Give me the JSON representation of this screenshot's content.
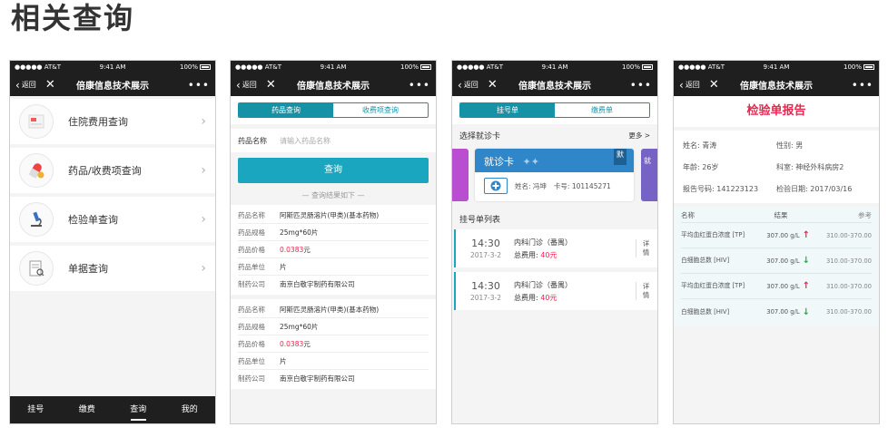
{
  "page_title": "相关查询",
  "status_bar": {
    "carrier": "●●●●● AT&T",
    "time": "9:41 AM",
    "battery": "100%"
  },
  "nav": {
    "back_label": "返回",
    "title": "倍康信息技术展示"
  },
  "phone1": {
    "menu": [
      {
        "label": "住院费用查询",
        "icon": "hospital-bill-icon"
      },
      {
        "label": "药品/收费项查询",
        "icon": "pill-icon"
      },
      {
        "label": "检验单查询",
        "icon": "microscope-icon"
      },
      {
        "label": "单据查询",
        "icon": "receipt-icon"
      }
    ],
    "tabs": [
      "挂号",
      "缴费",
      "查询",
      "我的"
    ],
    "active_tab": "查询"
  },
  "phone2": {
    "segments": [
      "药品查询",
      "收费项查询"
    ],
    "field_label": "药品名称",
    "field_placeholder": "请输入药品名称",
    "query_button": "查询",
    "divider": "— 查询结果如下 —",
    "result_keys": [
      "药品名称",
      "药品规格",
      "药品价格",
      "药品单位",
      "制药公司"
    ],
    "results": [
      {
        "name": "阿斯匹灵肠溶片(甲类)(基本药物)",
        "spec": "25mg*60片",
        "price": "0.0383",
        "price_unit": "元",
        "unit": "片",
        "company": "南京白敬宇制药有限公司"
      },
      {
        "name": "阿斯匹灵肠溶片(甲类)(基本药物)",
        "spec": "25mg*60片",
        "price": "0.0383",
        "price_unit": "元",
        "unit": "片",
        "company": "南京白敬宇制药有限公司"
      }
    ]
  },
  "phone3": {
    "segments": [
      "挂号单",
      "缴费单"
    ],
    "select_card_label": "选择就诊卡",
    "more_label": "更多 >",
    "card": {
      "title": "就诊卡",
      "badge": "默",
      "name_label": "姓名:",
      "name": "冯坤",
      "card_no_label": "卡号:",
      "card_no": "101145271",
      "side_text": "就"
    },
    "list_title": "挂号单列表",
    "registrations": [
      {
        "time": "14:30",
        "date": "2017-3-2",
        "dept": "内科门诊（番禺）",
        "fee_label": "总费用:",
        "fee": "40",
        "fee_unit": "元",
        "detail": "详情"
      },
      {
        "time": "14:30",
        "date": "2017-3-2",
        "dept": "内科门诊（番禺）",
        "fee_label": "总费用:",
        "fee": "40",
        "fee_unit": "元",
        "detail": "详情"
      }
    ]
  },
  "phone4": {
    "report_title": "检验单报告",
    "info": {
      "name": "姓名: 青涛",
      "gender": "性别: 男",
      "age": "年龄: 26岁",
      "dept": "科室: 神经外科病房2",
      "report_no": "报告号码: 141223123",
      "report_date": "检验日期: 2017/03/16"
    },
    "table_head": {
      "name": "名称",
      "result": "结果",
      "ref": "参考"
    },
    "rows": [
      {
        "name": "平均血红蛋白浓度 [TP]",
        "result": "307.00 g/L",
        "trend": "up",
        "ref": "310.00-370.00"
      },
      {
        "name": "白细胞总数 [HIV]",
        "result": "307.00 g/L",
        "trend": "down",
        "ref": "310.00-370.00"
      },
      {
        "name": "平均血红蛋白浓度 [TP]",
        "result": "307.00 g/L",
        "trend": "up",
        "ref": "310.00-370.00"
      },
      {
        "name": "白细胞总数 [HIV]",
        "result": "307.00 g/L",
        "trend": "down",
        "ref": "310.00-370.00"
      }
    ]
  },
  "colors": {
    "accent": "#1aa6bf",
    "price": "#e8264f",
    "dark_bar": "#1f1f1f",
    "card_blue": "#2f86c8"
  }
}
